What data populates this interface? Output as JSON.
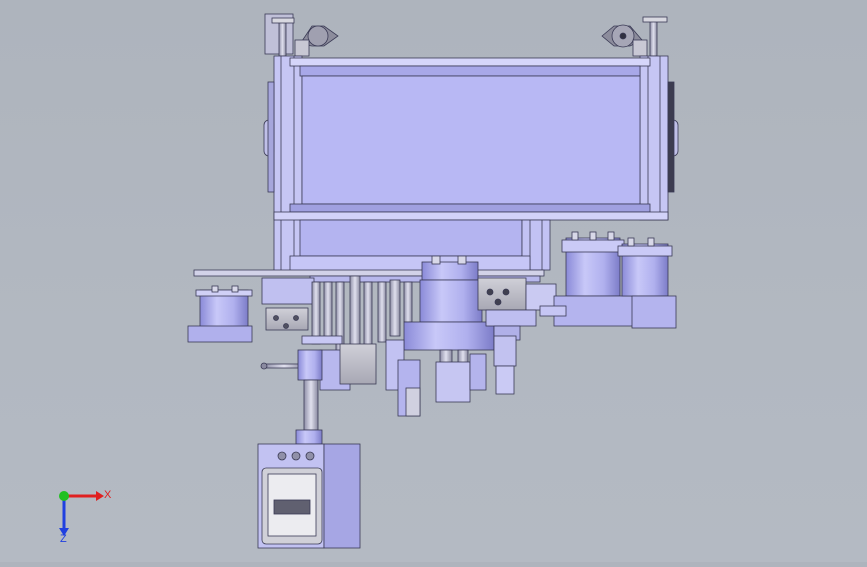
{
  "viewport": {
    "background": "#b1b7c0",
    "model_color": "#b4b4f0",
    "model_dark": "#8c8ce0",
    "model_light": "#d2d2fa",
    "edge_color": "#3a3a55"
  },
  "triad": {
    "x_label": "X",
    "z_label": "Z",
    "x_color": "#e02020",
    "y_color": "#20c020",
    "z_color": "#2040e0"
  },
  "icons": [
    "lamp-icon",
    "handle-icon",
    "coordinate-triad-icon"
  ]
}
